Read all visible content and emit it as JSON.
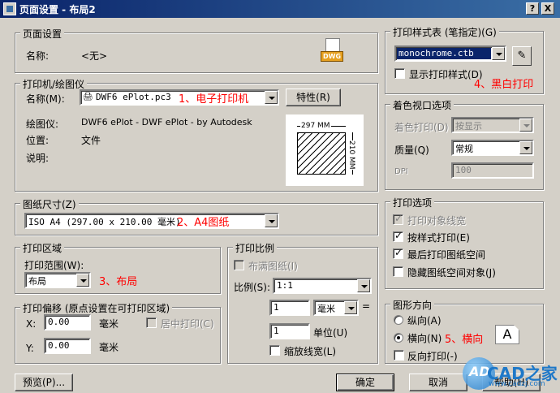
{
  "window": {
    "title": "页面设置 - 布局2",
    "help_btn": "?",
    "close_btn": "X"
  },
  "page_setup": {
    "title": "页面设置",
    "name_label": "名称:",
    "name_value": "<无>",
    "dwg_badge": "DWG"
  },
  "printer": {
    "title": "打印机/绘图仪",
    "name_label": "名称(M):",
    "name_value": "DWF6 ePlot.pc3",
    "properties_btn": "特性(R)",
    "plotter_label": "绘图仪:",
    "plotter_value": "DWF6 ePlot - DWF ePlot - by Autodesk",
    "location_label": "位置:",
    "location_value": "文件",
    "description_label": "说明:",
    "paper_width": "297 MM",
    "paper_height": "210 MM"
  },
  "paper_size": {
    "title": "图纸尺寸(Z)",
    "value": "ISO A4 (297.00 x 210.00 毫米)"
  },
  "plot_area": {
    "title": "打印区域",
    "range_label": "打印范围(W):",
    "range_value": "布局"
  },
  "plot_offset": {
    "title": "打印偏移 (原点设置在可打印区域)",
    "x_label": "X:",
    "x_value": "0.00",
    "x_unit": "毫米",
    "y_label": "Y:",
    "y_value": "0.00",
    "y_unit": "毫米",
    "center_label": "居中打印(C)"
  },
  "plot_scale": {
    "title": "打印比例",
    "fit_label": "布满图纸(I)",
    "scale_label": "比例(S):",
    "scale_value": "1:1",
    "value1": "1",
    "unit1": "毫米",
    "eq": "=",
    "value2": "1",
    "unit2": "单位(U)",
    "lineweights_label": "缩放线宽(L)"
  },
  "plot_style": {
    "title": "打印样式表 (笔指定)(G)",
    "value": "monochrome.ctb",
    "display_label": "显示打印样式(D)"
  },
  "shaded": {
    "title": "着色视口选项",
    "shade_label": "着色打印(D)",
    "shade_value": "按显示",
    "quality_label": "质量(Q)",
    "quality_value": "常规",
    "dpi_label": "DPI",
    "dpi_value": "100"
  },
  "options": {
    "title": "打印选项",
    "items": [
      {
        "label": "打印对象线宽",
        "checked": true,
        "disabled": true
      },
      {
        "label": "按样式打印(E)",
        "checked": true,
        "disabled": false
      },
      {
        "label": "最后打印图纸空间",
        "checked": true,
        "disabled": false
      },
      {
        "label": "隐藏图纸空间对象(J)",
        "checked": false,
        "disabled": false
      }
    ]
  },
  "orientation": {
    "title": "图形方向",
    "portrait": "纵向(A)",
    "landscape": "横向(N)",
    "upside_down": "反向打印(-)",
    "icon_letter": "A"
  },
  "annotations": {
    "a1": "1、电子打印机",
    "a2": "2、A4图纸",
    "a3": "3、布局",
    "a4": "4、黑白打印",
    "a5": "5、横向"
  },
  "buttons": {
    "preview": "预览(P)...",
    "ok": "确定",
    "cancel": "取消",
    "help": "帮助(H)"
  },
  "watermark": {
    "logo": "AD",
    "text": "CAD之家",
    "url": "www.cadzj.com"
  }
}
